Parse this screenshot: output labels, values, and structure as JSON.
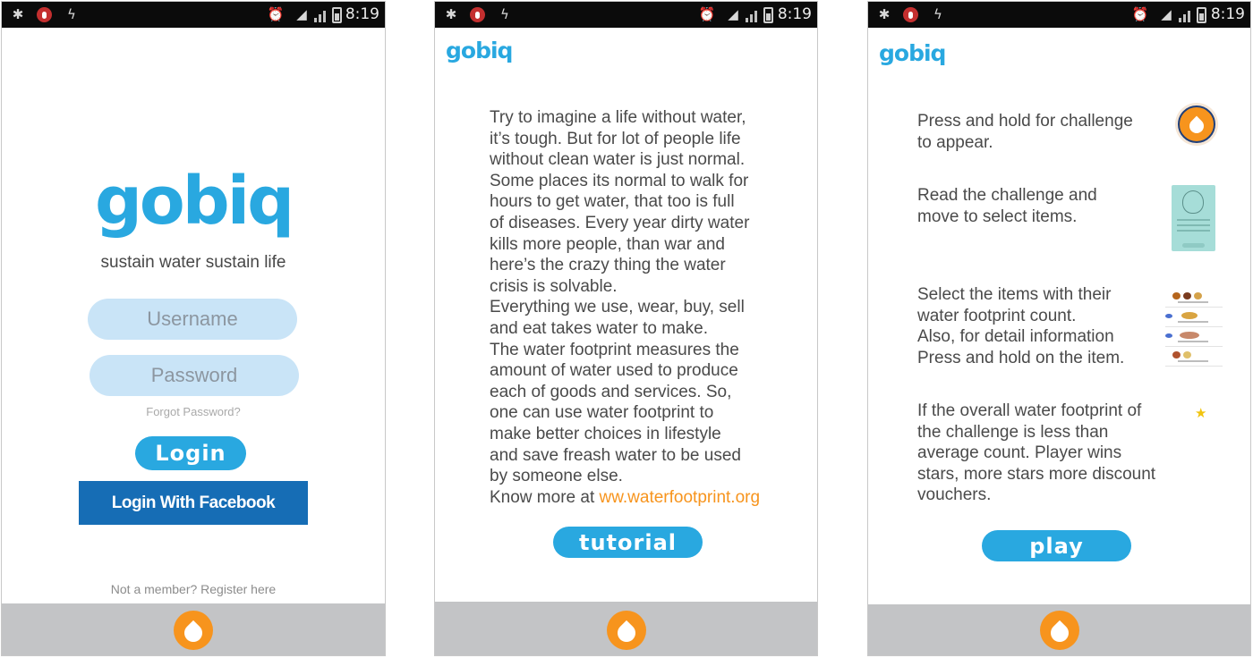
{
  "status_bar": {
    "time": "8:19"
  },
  "colors": {
    "brand_blue": "#29a8e0",
    "accent_orange": "#f7941d",
    "facebook_blue": "#166db5",
    "input_fill": "#c9e4f7",
    "nav_gray": "#c3c4c6"
  },
  "icons": {
    "status_left": [
      "debug-bug-icon",
      "mic-muted-icon",
      "charging-bolt-icon"
    ],
    "status_right": [
      "alarm-clock-icon",
      "wifi-icon",
      "signal-bars-icon",
      "battery-icon"
    ],
    "bottom_nav": "water-drop-icon"
  },
  "screen1": {
    "logo": "gobiq",
    "tagline": "sustain water sustain life",
    "username_placeholder": "Username",
    "password_placeholder": "Password",
    "forgot_password": "Forgot Password?",
    "login_button": "Login",
    "facebook_button": "Login With Facebook",
    "register_link": "Not a member? Register here"
  },
  "screen2": {
    "logo": "gobiq",
    "intro_text": "Try to imagine a life without water,\n it’s tough. But for lot of people life\nwithout clean water is just normal.\nSome places its normal to walk for\nhours to get water, that too is full\nof diseases. Every year dirty water\nkills more people, than war and\nhere’s the crazy thing the water\ncrisis is solvable.\nEverything we use, wear, buy, sell\nand eat takes water to make.\nThe water footprint measures the\namount of water used to produce\neach of goods and services. So,\none can use water footprint to\nmake better choices in lifestyle\nand save freash water to be used\nby someone else.",
    "know_more_prefix": "Know more at ",
    "know_more_link": "ww.waterfootprint.org",
    "tutorial_button": "tutorial"
  },
  "screen3": {
    "logo": "gobiq",
    "steps": [
      {
        "text": "Press and hold for challenge\nto appear.",
        "icon": "water-drop-button-icon"
      },
      {
        "text": "Read the challenge and\nmove to select items.",
        "icon": "challenge-card-icon"
      },
      {
        "text": "Select the items with their\nwater footprint count.\nAlso, for detail information\nPress and hold on the item.",
        "icon": "food-items-list-icon"
      },
      {
        "text": "If the overall water footprint of\nthe challenge is less than\naverage count. Player wins\nstars, more stars more discount\nvouchers.",
        "icon": "star-icon"
      }
    ],
    "play_button": "play"
  }
}
